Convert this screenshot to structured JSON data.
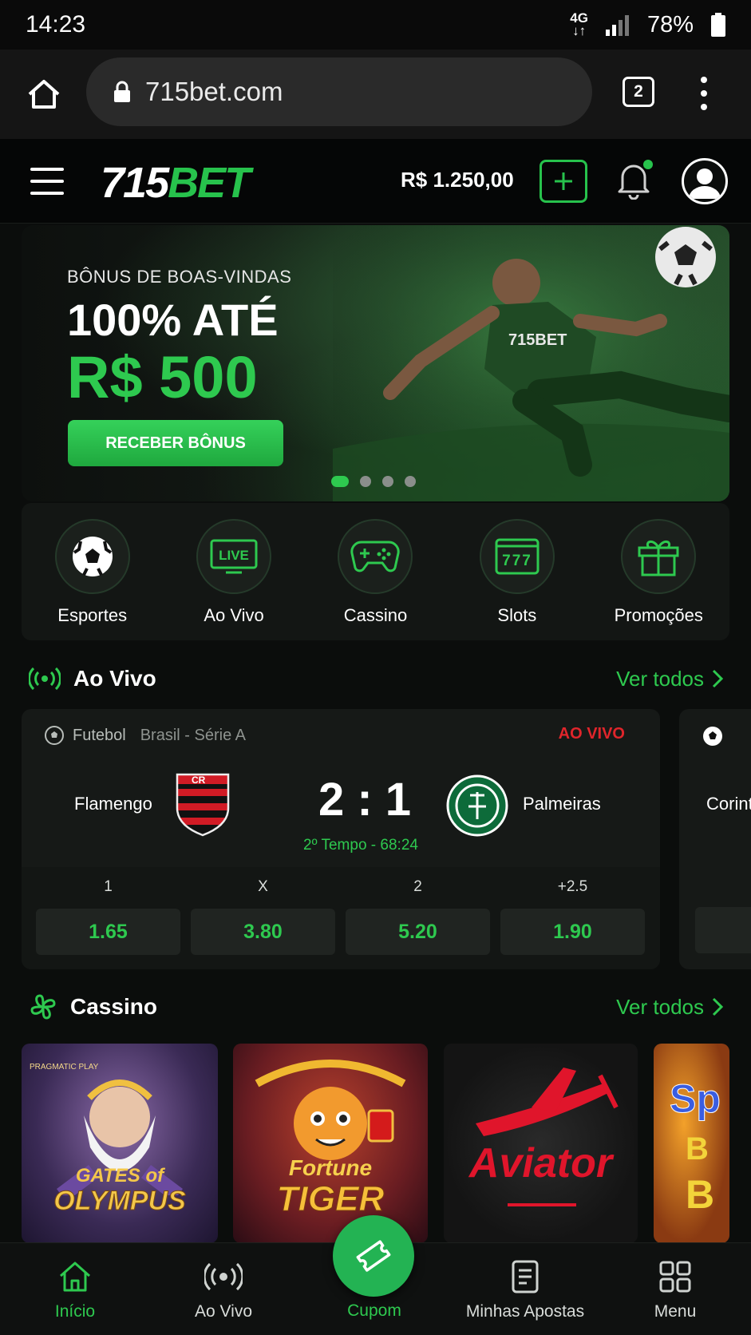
{
  "status_bar": {
    "time": "14:23",
    "network_top": "4G",
    "network_bottom": "↓↑",
    "battery": "78%"
  },
  "browser": {
    "url": "715bet.com",
    "tab_count": "2"
  },
  "header": {
    "logo_number": "715",
    "logo_brand": "BET",
    "balance": "R$ 1.250,00"
  },
  "banner": {
    "subtitle": "BÔNUS DE BOAS-VINDAS",
    "title": "100% ATÉ",
    "amount": "R$ 500",
    "cta": "RECEBER BÔNUS",
    "jersey_text": "715BET",
    "active_slide": 1,
    "slide_count": 4
  },
  "categories": [
    {
      "label": "Esportes",
      "icon": "soccer-ball-icon"
    },
    {
      "label": "Ao Vivo",
      "icon": "live-tv-icon",
      "icon_text": "LIVE"
    },
    {
      "label": "Cassino",
      "icon": "gamepad-icon"
    },
    {
      "label": "Slots",
      "icon": "slot-machine-icon",
      "icon_text": "777"
    },
    {
      "label": "Promoções",
      "icon": "gift-icon"
    }
  ],
  "live_section": {
    "title": "Ao Vivo",
    "see_all": "Ver todos"
  },
  "match": {
    "sport": "Futebol",
    "league": "Brasil - Série A",
    "status": "AO VIVO",
    "home_team": "Flamengo",
    "away_team": "Palmeiras",
    "score": "2 : 1",
    "time": "2º Tempo - 68:24",
    "odds": [
      {
        "label": "1",
        "value": "1.65"
      },
      {
        "label": "X",
        "value": "3.80"
      },
      {
        "label": "2",
        "value": "5.20"
      },
      {
        "label": "+2.5",
        "value": "1.90"
      }
    ],
    "next_match_peek": "Corint"
  },
  "casino_section": {
    "title": "Cassino",
    "see_all": "Ver todos",
    "games": [
      {
        "line1": "GATES of",
        "line2": "OLYMPUS",
        "provider": "PRAGMATIC PLAY"
      },
      {
        "line1": "Fortune",
        "line2": "TIGER"
      },
      {
        "line1": "Aviator"
      },
      {
        "line1": "Sp",
        "line2": "B",
        "line3": "B"
      }
    ]
  },
  "bottom_nav": {
    "items": [
      {
        "label": "Início",
        "icon": "home-icon",
        "active": true
      },
      {
        "label": "Ao Vivo",
        "icon": "live-broadcast-icon",
        "active": false
      },
      {
        "label": "Cupom",
        "icon": "ticket-icon",
        "active": false
      },
      {
        "label": "Minhas Apostas",
        "icon": "document-icon",
        "active": false
      },
      {
        "label": "Menu",
        "icon": "grid-icon",
        "active": false
      }
    ]
  },
  "colors": {
    "accent": "#2ec94f",
    "live_red": "#e0252b",
    "background": "#0b0d0c",
    "card": "#161917"
  }
}
